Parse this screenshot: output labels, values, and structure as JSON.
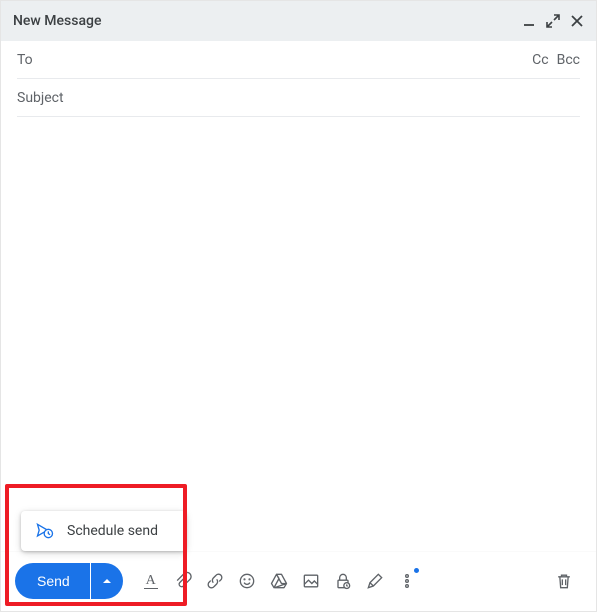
{
  "header": {
    "title": "New Message"
  },
  "fields": {
    "to_label": "To",
    "cc_label": "Cc",
    "bcc_label": "Bcc",
    "subject_label": "Subject"
  },
  "send": {
    "label": "Send"
  },
  "schedule": {
    "label": "Schedule send"
  }
}
